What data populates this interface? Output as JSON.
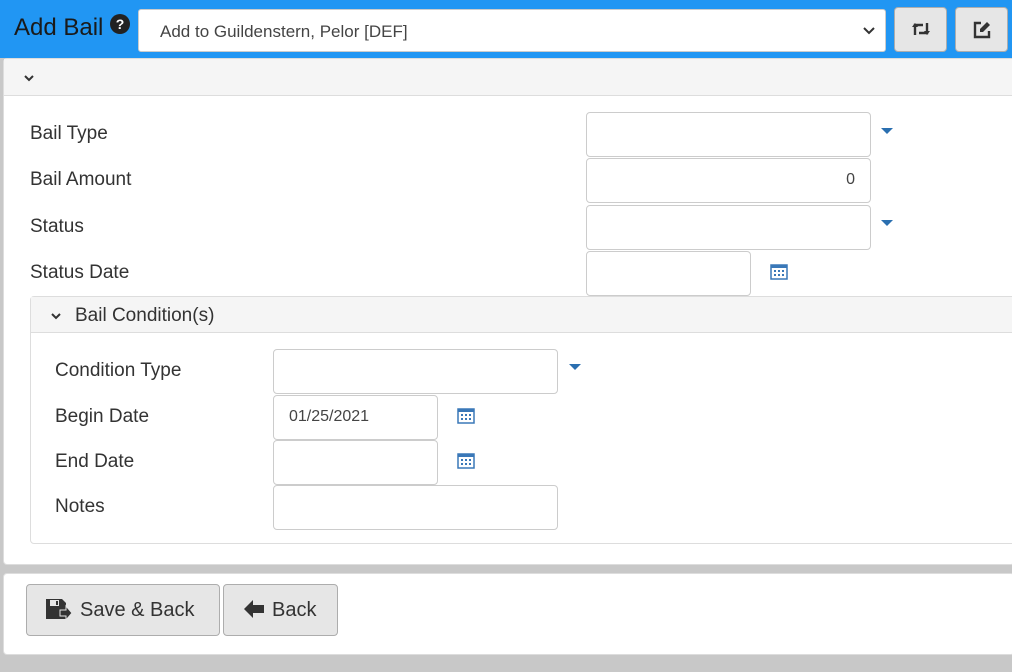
{
  "header": {
    "title": "Add Bail",
    "help_icon": "?",
    "target_select": {
      "value": "Add to Guildenstern, Pelor [DEF]"
    },
    "icons": {
      "swap": "retweet-icon",
      "edit": "edit-icon",
      "help": "question-circle-icon"
    }
  },
  "form": {
    "bail_type": {
      "label": "Bail Type",
      "value": ""
    },
    "bail_amount": {
      "label": "Bail Amount",
      "value": "0"
    },
    "status": {
      "label": "Status",
      "value": ""
    },
    "status_date": {
      "label": "Status Date",
      "value": ""
    }
  },
  "conditions": {
    "title": "Bail Condition(s)",
    "condition_type": {
      "label": "Condition Type",
      "value": ""
    },
    "begin_date": {
      "label": "Begin Date",
      "value": "01/25/2021"
    },
    "end_date": {
      "label": "End Date",
      "value": ""
    },
    "notes": {
      "label": "Notes",
      "value": ""
    }
  },
  "footer": {
    "save_back_label": "Save & Back",
    "back_label": "Back"
  },
  "colors": {
    "header_bg": "#2196f3",
    "caret": "#2a6fb0",
    "button_bg": "#e6e6e6"
  }
}
